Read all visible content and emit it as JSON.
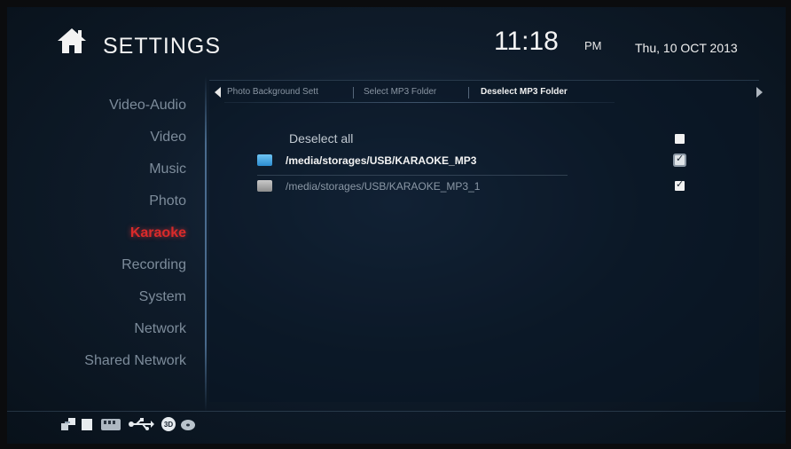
{
  "header": {
    "title": "SETTINGS",
    "time": "11:18",
    "ampm": "PM",
    "date": "Thu, 10 OCT 2013"
  },
  "sidebar": {
    "items": [
      {
        "label": "Video-Audio"
      },
      {
        "label": "Video"
      },
      {
        "label": "Music"
      },
      {
        "label": "Photo"
      },
      {
        "label": "Karaoke",
        "active": true
      },
      {
        "label": "Recording"
      },
      {
        "label": "System"
      },
      {
        "label": "Network"
      },
      {
        "label": "Shared Network"
      }
    ]
  },
  "tabs": [
    {
      "label": "Photo Background Sett"
    },
    {
      "label": "Select MP3 Folder"
    },
    {
      "label": "Deselect MP3 Folder",
      "active": true
    }
  ],
  "content": {
    "deselect_all_label": "Deselect all",
    "deselect_all_checked": false,
    "folders": [
      {
        "path": "/media/storages/USB/KARAOKE_MP3",
        "checked": true,
        "focused": true
      },
      {
        "path": "/media/storages/USB/KARAOKE_MP3_1",
        "checked": true,
        "focused": false
      }
    ]
  },
  "statusbar": {
    "icons": [
      "network-icon",
      "storage-icon",
      "sd-card-icon",
      "usb-icon",
      "3d-icon",
      "disc-icon"
    ],
    "three_d_label": "3D"
  },
  "colors": {
    "active_menu": "#d92a2a",
    "folder_selected": "#2c8ccf",
    "folder_unselected": "#8d8d8d"
  }
}
